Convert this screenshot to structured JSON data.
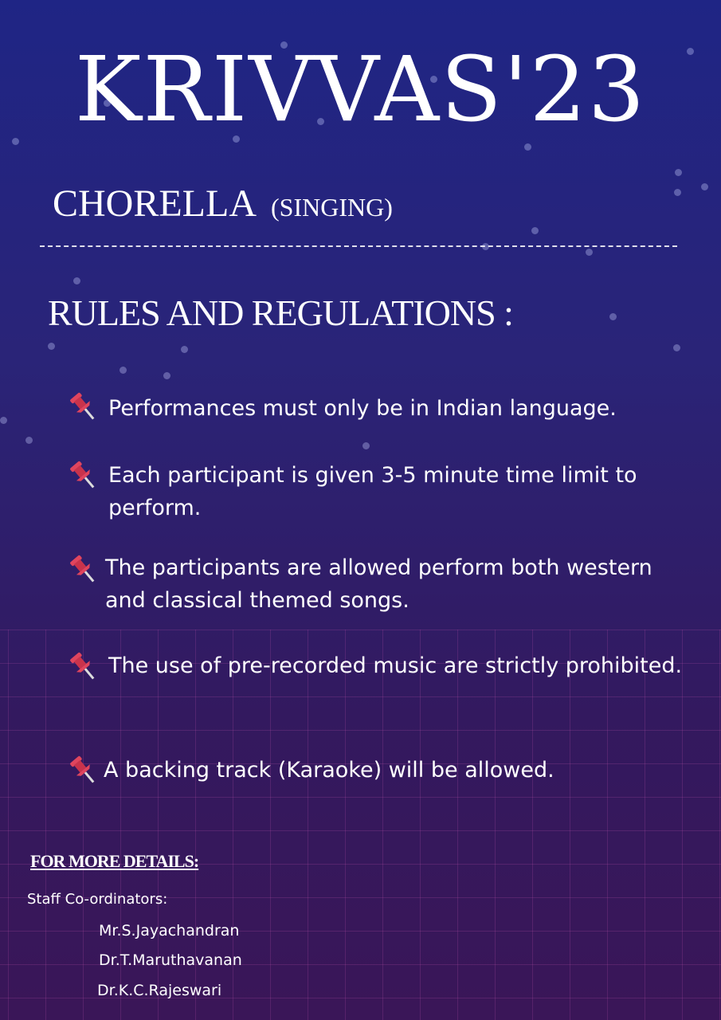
{
  "poster": {
    "title": "KRIVVAS'23",
    "event_name": "CHORELLA",
    "event_type": "(SINGING)",
    "rules_heading": "RULES AND REGULATIONS :",
    "rules": [
      "Performances must only be in Indian language.",
      "Each participant is given 3-5 minute time limit to perform.",
      "The participants are allowed perform both western and classical themed songs.",
      "The use of pre-recorded music are strictly prohibited.",
      "A backing track (Karaoke) will be allowed."
    ],
    "rule_icon": "pushpin-icon",
    "details_title": "FOR MORE DETAILS:",
    "coordinators_label": "Staff Co-ordinators:",
    "coordinators": [
      "Mr.S.Jayachandran",
      "Dr.T.Maruthavanan",
      "Dr.K.C.Rajeswari"
    ]
  },
  "colors": {
    "background_top": "#1f2585",
    "background_bottom": "#3a1658",
    "text": "#ffffff",
    "pin_red": "#e0455e"
  }
}
